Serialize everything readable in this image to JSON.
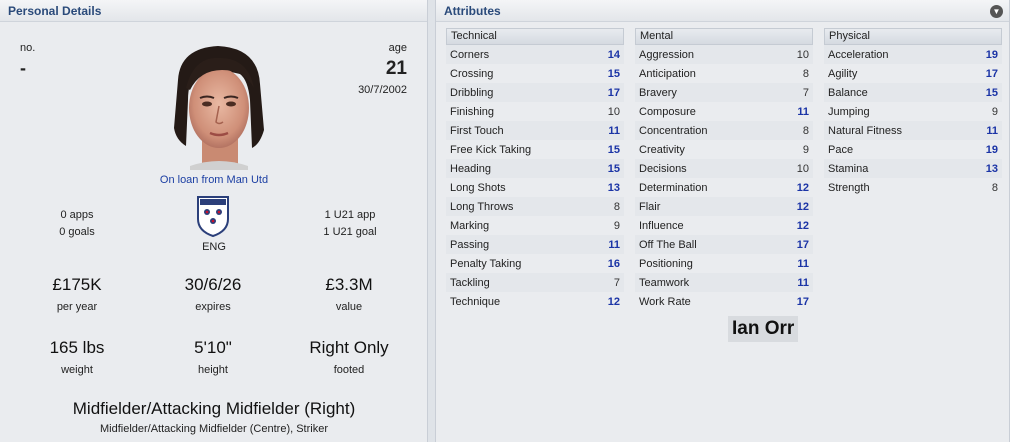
{
  "personal": {
    "title": "Personal Details",
    "no_label": "no.",
    "no_value": "-",
    "age_label": "age",
    "age_value": "21",
    "dob": "30/7/2002",
    "loan_text": "On loan from Man Utd",
    "apps": "0 apps",
    "goals": "0 goals",
    "u21_app": "1 U21 app",
    "u21_goal": "1 U21 goal",
    "nation": "ENG",
    "wage_value": "£175K",
    "wage_label": "per year",
    "expires_value": "30/6/26",
    "expires_label": "expires",
    "value_value": "£3.3M",
    "value_label": "value",
    "weight_value": "165 lbs",
    "weight_label": "weight",
    "height_value": "5'10\"",
    "height_label": "height",
    "foot_value": "Right Only",
    "foot_label": "footed",
    "position_main": "Midfielder/Attacking Midfielder (Right)",
    "position_sub": "Midfielder/Attacking Midfielder (Centre), Striker"
  },
  "attributes": {
    "title": "Attributes",
    "technical": {
      "title": "Technical",
      "items": [
        {
          "name": "Corners",
          "value": "14"
        },
        {
          "name": "Crossing",
          "value": "15"
        },
        {
          "name": "Dribbling",
          "value": "17"
        },
        {
          "name": "Finishing",
          "value": "10"
        },
        {
          "name": "First Touch",
          "value": "11"
        },
        {
          "name": "Free Kick Taking",
          "value": "15"
        },
        {
          "name": "Heading",
          "value": "15"
        },
        {
          "name": "Long Shots",
          "value": "13"
        },
        {
          "name": "Long Throws",
          "value": "8"
        },
        {
          "name": "Marking",
          "value": "9"
        },
        {
          "name": "Passing",
          "value": "11"
        },
        {
          "name": "Penalty Taking",
          "value": "16"
        },
        {
          "name": "Tackling",
          "value": "7"
        },
        {
          "name": "Technique",
          "value": "12"
        }
      ]
    },
    "mental": {
      "title": "Mental",
      "items": [
        {
          "name": "Aggression",
          "value": "10"
        },
        {
          "name": "Anticipation",
          "value": "8"
        },
        {
          "name": "Bravery",
          "value": "7"
        },
        {
          "name": "Composure",
          "value": "11"
        },
        {
          "name": "Concentration",
          "value": "8"
        },
        {
          "name": "Creativity",
          "value": "9"
        },
        {
          "name": "Decisions",
          "value": "10"
        },
        {
          "name": "Determination",
          "value": "12"
        },
        {
          "name": "Flair",
          "value": "12"
        },
        {
          "name": "Influence",
          "value": "12"
        },
        {
          "name": "Off The Ball",
          "value": "17"
        },
        {
          "name": "Positioning",
          "value": "11"
        },
        {
          "name": "Teamwork",
          "value": "11"
        },
        {
          "name": "Work Rate",
          "value": "17"
        }
      ]
    },
    "physical": {
      "title": "Physical",
      "items": [
        {
          "name": "Acceleration",
          "value": "19"
        },
        {
          "name": "Agility",
          "value": "17"
        },
        {
          "name": "Balance",
          "value": "15"
        },
        {
          "name": "Jumping",
          "value": "9"
        },
        {
          "name": "Natural Fitness",
          "value": "11"
        },
        {
          "name": "Pace",
          "value": "19"
        },
        {
          "name": "Stamina",
          "value": "13"
        },
        {
          "name": "Strength",
          "value": "8"
        }
      ]
    },
    "player_name": "Ian Orr"
  },
  "colors": {
    "high_value": "#1b34a6",
    "loan_link": "#1c3fa3",
    "section_title": "#2a4a7a"
  },
  "icons": {
    "collapse": "chevron-down-circle-icon",
    "crest": "england-crest-icon"
  }
}
